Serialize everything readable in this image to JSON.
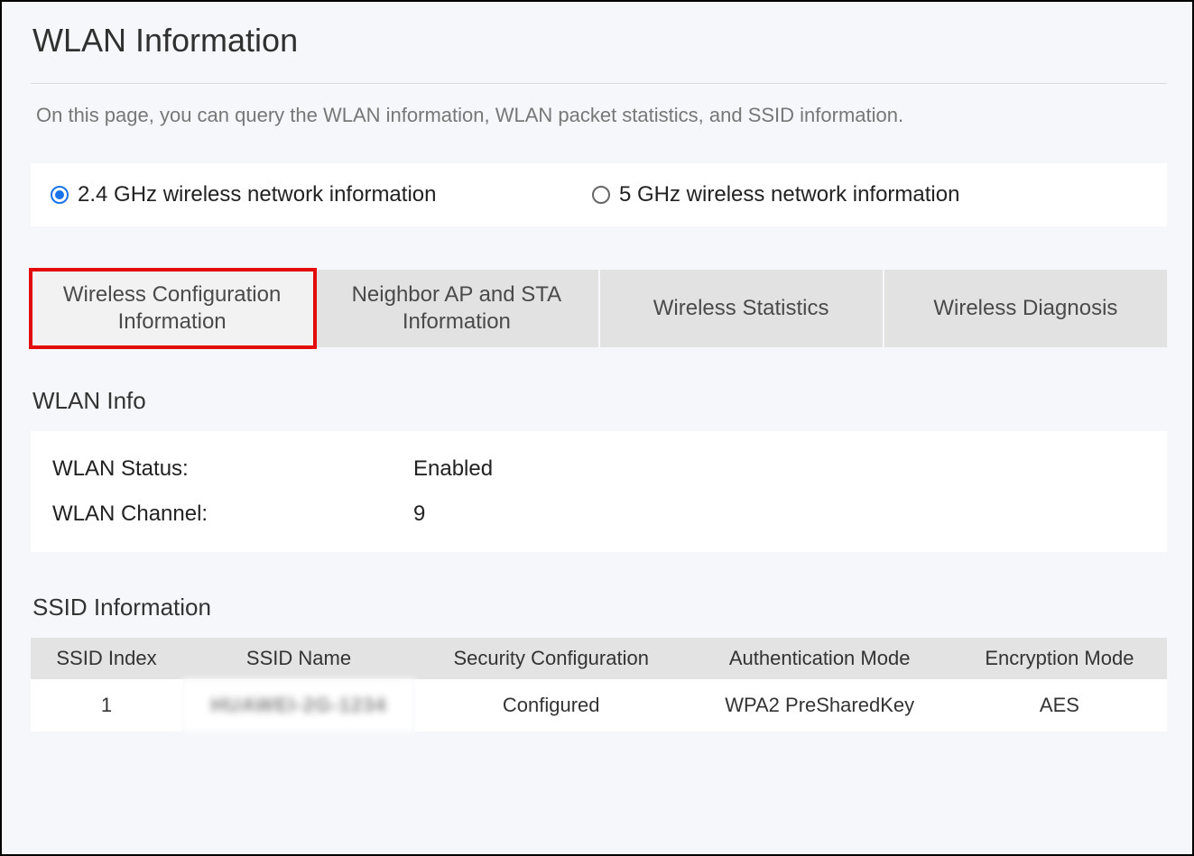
{
  "page": {
    "title": "WLAN Information",
    "hint": "On this page, you can query the WLAN information, WLAN packet statistics, and SSID information."
  },
  "band": {
    "options": [
      "2.4 GHz wireless network information",
      "5 GHz wireless network information"
    ],
    "selected_index": 0
  },
  "tabs": {
    "items": [
      "Wireless Configuration Information",
      "Neighbor AP and STA Information",
      "Wireless Statistics",
      "Wireless Diagnosis"
    ],
    "active_index": 0
  },
  "wlan_info": {
    "section_title": "WLAN Info",
    "rows": [
      {
        "label": "WLAN Status:",
        "value": "Enabled"
      },
      {
        "label": "WLAN Channel:",
        "value": "9"
      }
    ]
  },
  "ssid": {
    "section_title": "SSID Information",
    "headers": [
      "SSID Index",
      "SSID Name",
      "Security Configuration",
      "Authentication Mode",
      "Encryption Mode"
    ],
    "rows": [
      {
        "index": "1",
        "name": "HUAWEI-2G-1234",
        "security": "Configured",
        "auth": "WPA2 PreSharedKey",
        "encryption": "AES"
      }
    ]
  }
}
